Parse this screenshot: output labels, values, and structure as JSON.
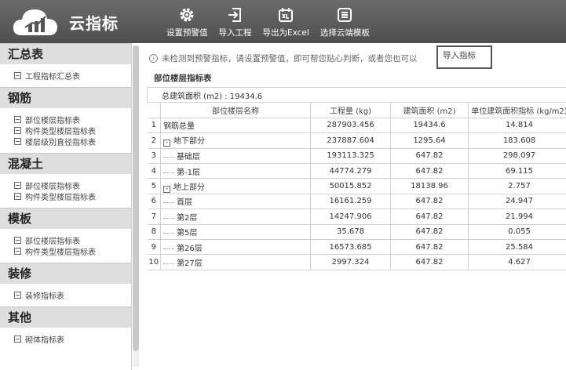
{
  "app": {
    "title": "云指标"
  },
  "toolbar": [
    {
      "label": "设置预警值",
      "icon": "gear-icon"
    },
    {
      "label": "导入工程",
      "icon": "import-icon"
    },
    {
      "label": "导出为Excel",
      "icon": "excel-icon"
    },
    {
      "label": "选择云端模板",
      "icon": "template-icon"
    }
  ],
  "sidebar": {
    "sections": [
      {
        "title": "汇总表",
        "items": [
          "工程指标汇总表"
        ]
      },
      {
        "title": "钢筋",
        "items": [
          "部位楼层指标表",
          "构件类型楼层指标表",
          "楼层级别直径指标表"
        ]
      },
      {
        "title": "混凝土",
        "items": [
          "部位楼层指标表",
          "构件类型楼层指标表"
        ]
      },
      {
        "title": "模板",
        "items": [
          "部位楼层指标表",
          "构件类型楼层指标表"
        ]
      },
      {
        "title": "装修",
        "items": [
          "装修指标表"
        ]
      },
      {
        "title": "其他",
        "items": [
          "砌体指标表"
        ]
      }
    ]
  },
  "notice": {
    "icon": "info-icon",
    "text": "未检测到预警指标，请设置预警值，即可帮您贴心判断，或者您也可以",
    "button": "导入指标"
  },
  "section_title": "部位楼层指标表",
  "total_area": "总建筑面积 (m2) : 19434.6",
  "table": {
    "headers": [
      "部位楼层名称",
      "工程量 (kg)",
      "建筑面积 (m2)",
      "单位建筑面积指标 (kg/m2)"
    ],
    "rows": [
      {
        "idx": "1",
        "name": "钢筋总量",
        "qty": "287903.456",
        "area": "19434.6",
        "index": "14.814"
      },
      {
        "idx": "2",
        "name": "地下部分",
        "qty": "237887.604",
        "area": "1295.64",
        "index": "183.608"
      },
      {
        "idx": "3",
        "name": "基础层",
        "qty": "193113.325",
        "area": "647.82",
        "index": "298.097"
      },
      {
        "idx": "4",
        "name": "第-1层",
        "qty": "44774.279",
        "area": "647.82",
        "index": "69.115"
      },
      {
        "idx": "5",
        "name": "地上部分",
        "qty": "50015.852",
        "area": "18138.96",
        "index": "2.757"
      },
      {
        "idx": "6",
        "name": "首层",
        "qty": "16161.259",
        "area": "647.82",
        "index": "24.947"
      },
      {
        "idx": "7",
        "name": "第2层",
        "qty": "14247.906",
        "area": "647.82",
        "index": "21.994"
      },
      {
        "idx": "8",
        "name": "第5层",
        "qty": "35.678",
        "area": "647.82",
        "index": "0.055"
      },
      {
        "idx": "9",
        "name": "第26层",
        "qty": "16573.685",
        "area": "647.82",
        "index": "25.584"
      },
      {
        "idx": "10",
        "name": "第27层",
        "qty": "2997.324",
        "area": "647.82",
        "index": "4.627"
      }
    ]
  }
}
